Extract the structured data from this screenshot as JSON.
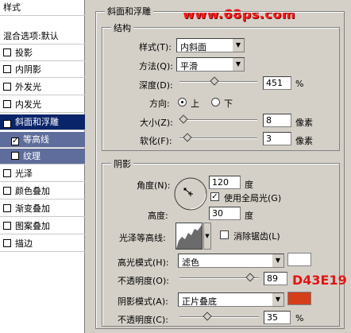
{
  "left_panel": {
    "items": [
      {
        "label": "样式",
        "checked": null
      },
      {
        "label": "混合选项:默认",
        "checked": null
      },
      {
        "label": "投影",
        "checked": false
      },
      {
        "label": "内阴影",
        "checked": false
      },
      {
        "label": "外发光",
        "checked": false
      },
      {
        "label": "内发光",
        "checked": false
      },
      {
        "label": "斜面和浮雕",
        "checked": true
      },
      {
        "label": "等高线",
        "checked": true
      },
      {
        "label": "纹理",
        "checked": false
      },
      {
        "label": "光泽",
        "checked": false
      },
      {
        "label": "颜色叠加",
        "checked": false
      },
      {
        "label": "渐变叠加",
        "checked": false
      },
      {
        "label": "图案叠加",
        "checked": false
      },
      {
        "label": "描边",
        "checked": false
      }
    ]
  },
  "watermark": "www.68ps.com",
  "bevel": {
    "title": "斜面和浮雕",
    "structure": {
      "title": "结构",
      "style_label": "样式(T):",
      "style_value": "内斜面",
      "method_label": "方法(Q):",
      "method_value": "平滑",
      "depth_label": "深度(D):",
      "depth_value": "451",
      "depth_unit": "%",
      "depth_slider": 0.45,
      "direction_label": "方向:",
      "direction_up": "上",
      "direction_down": "下",
      "size_label": "大小(Z):",
      "size_value": "8",
      "size_unit": "像素",
      "size_slider": 0.05,
      "soften_label": "软化(F):",
      "soften_value": "3",
      "soften_unit": "像素",
      "soften_slider": 0.1
    },
    "shading": {
      "title": "阴影",
      "angle_label": "角度(N):",
      "angle_value": "120",
      "angle_unit": "度",
      "global_light_label": "使用全局光(G)",
      "altitude_label": "高度:",
      "altitude_value": "30",
      "altitude_unit": "度",
      "gloss_label": "光泽等高线:",
      "anti_alias_label": "消除锯齿(L)",
      "highlight_mode_label": "高光模式(H):",
      "highlight_mode_value": "滤色",
      "highlight_color": "#ffffff",
      "highlight_opacity_label": "不透明度(O):",
      "highlight_opacity_value": "89",
      "highlight_opacity_unit": "%",
      "highlight_opacity_slider": 0.89,
      "shadow_mode_label": "阴影模式(A):",
      "shadow_mode_value": "正片叠底",
      "shadow_color": "#D43E19",
      "shadow_color_label": "D43E19",
      "shadow_opacity_label": "不透明度(C):",
      "shadow_opacity_value": "35",
      "shadow_opacity_unit": "%",
      "shadow_opacity_slider": 0.35
    }
  }
}
